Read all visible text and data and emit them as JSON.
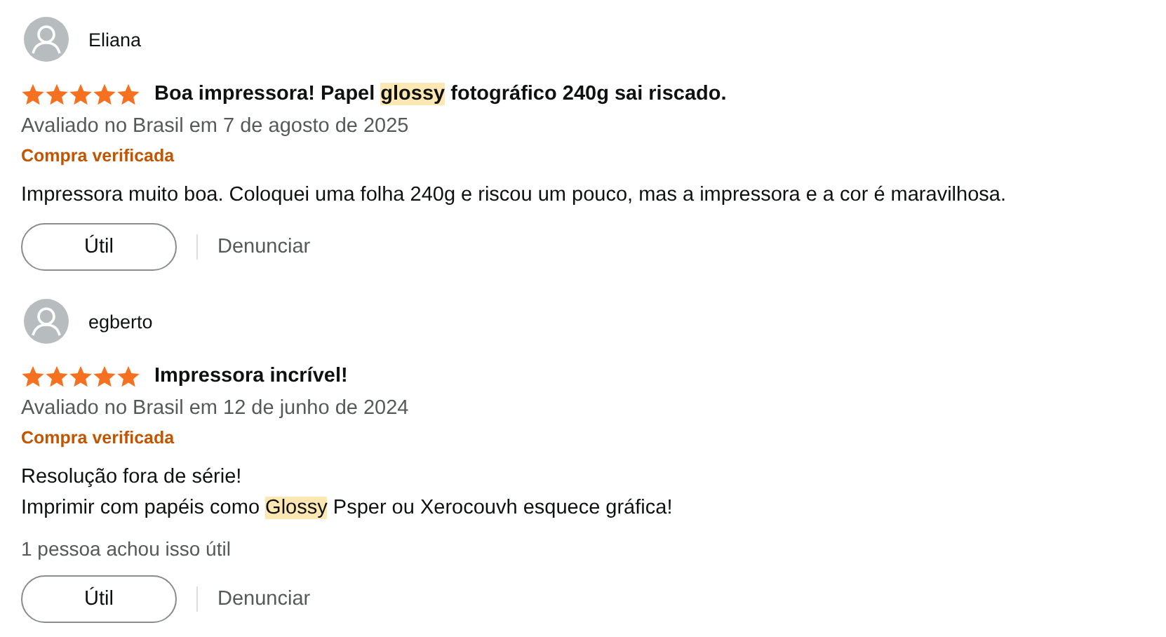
{
  "reviews": [
    {
      "author": "Eliana",
      "stars": 5,
      "title": [
        {
          "text": "Boa impressora! Papel ",
          "highlight": false
        },
        {
          "text": "glossy",
          "highlight": true
        },
        {
          "text": " fotográfico 240g sai riscado.",
          "highlight": false
        }
      ],
      "date": "Avaliado no Brasil em 7 de agosto de 2025",
      "verified": "Compra verificada",
      "body": [
        [
          {
            "text": "Impressora muito boa. Coloquei uma folha 240g e riscou um pouco, mas a impressora e a cor é maravilhosa.",
            "highlight": false
          }
        ]
      ],
      "helpful_button": "Útil",
      "report_link": "Denunciar"
    },
    {
      "author": "egberto",
      "stars": 5,
      "title": [
        {
          "text": "Impressora incrível!",
          "highlight": false
        }
      ],
      "date": "Avaliado no Brasil em 12 de junho de 2024",
      "verified": "Compra verificada",
      "body": [
        [
          {
            "text": "Resolução fora de série!",
            "highlight": false
          }
        ],
        [
          {
            "text": "Imprimir com papéis como ",
            "highlight": false
          },
          {
            "text": "Glossy",
            "highlight": true
          },
          {
            "text": " Psper ou Xerocouvh esquece gráfica!",
            "highlight": false
          }
        ]
      ],
      "helpful_count": "1 pessoa achou isso útil",
      "helpful_button": "Útil",
      "report_link": "Denunciar"
    }
  ]
}
